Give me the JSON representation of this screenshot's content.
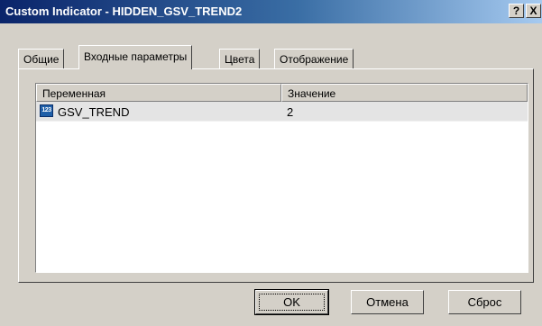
{
  "window": {
    "title": "Custom Indicator - HIDDEN_GSV_TREND2",
    "help_label": "?",
    "close_label": "X"
  },
  "tabs": [
    {
      "label": "Общие",
      "active": false
    },
    {
      "label": "Входные параметры",
      "active": true
    },
    {
      "label": "Цвета",
      "active": false
    },
    {
      "label": "Отображение",
      "active": false
    }
  ],
  "table": {
    "columns": [
      "Переменная",
      "Значение"
    ],
    "rows": [
      {
        "icon": "integer-param-icon",
        "icon_text": "123",
        "name": "GSV_TREND",
        "value": "2"
      }
    ]
  },
  "buttons": {
    "ok": "OK",
    "cancel": "Отмена",
    "reset": "Сброс"
  },
  "colors": {
    "title_gradient_start": "#0a246a",
    "title_gradient_end": "#a6caf0",
    "dialog_face": "#d4d0c8",
    "selected_row": "#e4e4e4"
  }
}
